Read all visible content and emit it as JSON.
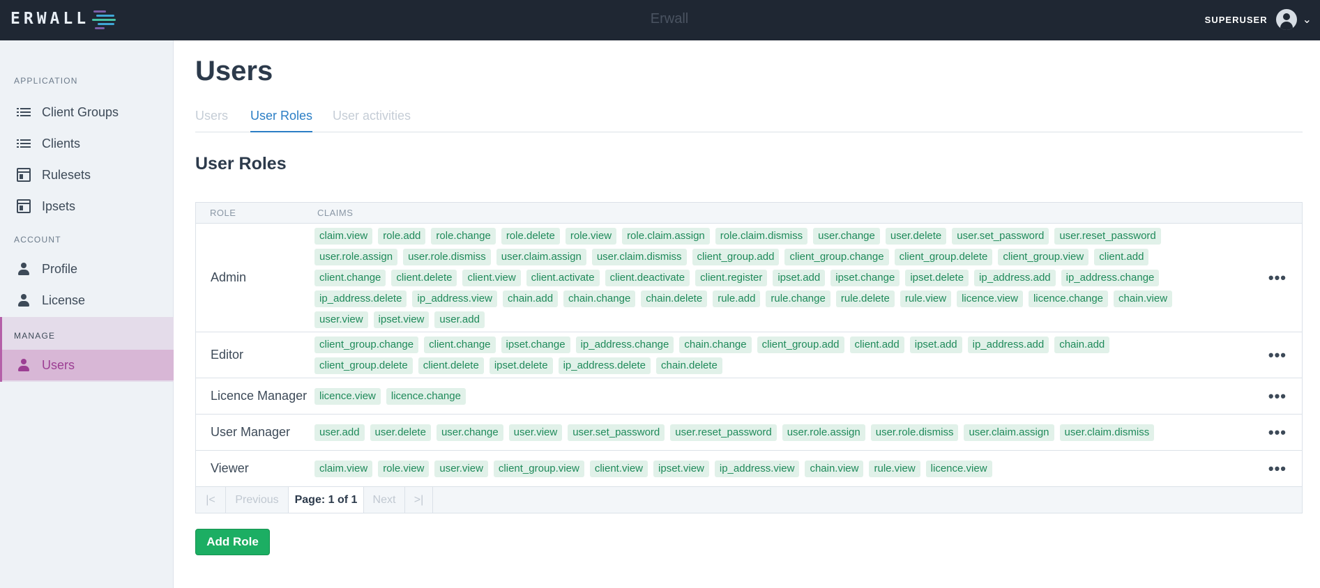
{
  "brand": {
    "logo_text": "ERWALL"
  },
  "header": {
    "title": "Erwall",
    "user": "SUPERUSER"
  },
  "sidebar": {
    "application_label": "APPLICATION",
    "account_label": "ACCOUNT",
    "manage_label": "MANAGE",
    "items": [
      {
        "label": "Client Groups",
        "icon": "list-icon"
      },
      {
        "label": "Clients",
        "icon": "list-icon"
      },
      {
        "label": "Rulesets",
        "icon": "window-icon"
      },
      {
        "label": "Ipsets",
        "icon": "window-icon"
      },
      {
        "label": "Profile",
        "icon": "person-icon"
      },
      {
        "label": "License",
        "icon": "person-icon"
      },
      {
        "label": "Users",
        "icon": "person-icon",
        "active": true
      }
    ]
  },
  "main": {
    "title": "Users",
    "tabs": [
      "Users",
      "User Roles",
      "User activities"
    ],
    "active_tab": "User Roles",
    "section_title": "User Roles",
    "table": {
      "columns": [
        "ROLE",
        "CLAIMS"
      ],
      "rows": [
        {
          "role": "Admin",
          "claims": [
            "claim.view",
            "role.add",
            "role.change",
            "role.delete",
            "role.view",
            "role.claim.assign",
            "role.claim.dismiss",
            "user.change",
            "user.delete",
            "user.set_password",
            "user.reset_password",
            "user.role.assign",
            "user.role.dismiss",
            "user.claim.assign",
            "user.claim.dismiss",
            "client_group.add",
            "client_group.change",
            "client_group.delete",
            "client_group.view",
            "client.add",
            "client.change",
            "client.delete",
            "client.view",
            "client.activate",
            "client.deactivate",
            "client.register",
            "ipset.add",
            "ipset.change",
            "ipset.delete",
            "ip_address.add",
            "ip_address.change",
            "ip_address.delete",
            "ip_address.view",
            "chain.add",
            "chain.change",
            "chain.delete",
            "rule.add",
            "rule.change",
            "rule.delete",
            "rule.view",
            "licence.view",
            "licence.change",
            "chain.view",
            "user.view",
            "ipset.view",
            "user.add"
          ]
        },
        {
          "role": "Editor",
          "claims": [
            "client_group.change",
            "client.change",
            "ipset.change",
            "ip_address.change",
            "chain.change",
            "client_group.add",
            "client.add",
            "ipset.add",
            "ip_address.add",
            "chain.add",
            "client_group.delete",
            "client.delete",
            "ipset.delete",
            "ip_address.delete",
            "chain.delete"
          ]
        },
        {
          "role": "Licence Manager",
          "claims": [
            "licence.view",
            "licence.change"
          ]
        },
        {
          "role": "User Manager",
          "claims": [
            "user.add",
            "user.delete",
            "user.change",
            "user.view",
            "user.set_password",
            "user.reset_password",
            "user.role.assign",
            "user.role.dismiss",
            "user.claim.assign",
            "user.claim.dismiss"
          ]
        },
        {
          "role": "Viewer",
          "claims": [
            "claim.view",
            "role.view",
            "user.view",
            "client_group.view",
            "client.view",
            "ipset.view",
            "ip_address.view",
            "chain.view",
            "rule.view",
            "licence.view"
          ]
        }
      ],
      "row_menu": "•••"
    },
    "pagination": {
      "first": "|<",
      "previous": "Previous",
      "page_label": "Page: 1 of 1",
      "next": "Next",
      "last": ">|"
    },
    "add_button": "Add Role"
  },
  "colors": {
    "navbar": "#1f2733",
    "accent": "#2b7ec5",
    "manage": "#9c3e93",
    "tag_bg": "#e1f1e9",
    "tag_text": "#1f8a5a",
    "button": "#1cae63"
  }
}
